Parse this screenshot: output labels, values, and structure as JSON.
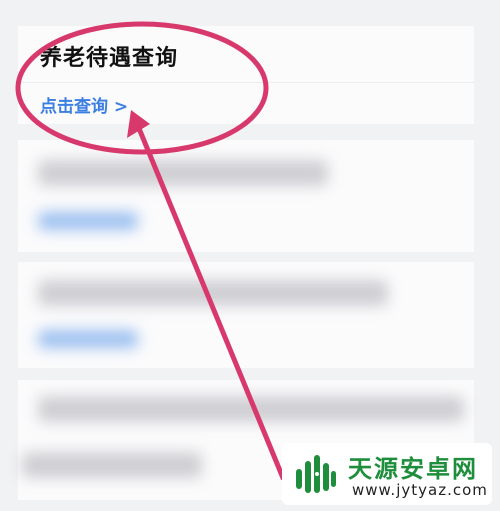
{
  "card": {
    "title": "养老待遇查询",
    "link_label": "点击查询 >"
  },
  "watermark": {
    "site_name": "天源安卓网",
    "site_url": "www.jytyaz.com"
  },
  "colors": {
    "page_background": "#f1f2f4",
    "card_background": "#fbfbfc",
    "link_blue": "#3b7fe0",
    "annotation_pink": "#d8396c",
    "watermark_green": "#1f8e3c"
  },
  "icons": [
    "android-logo-icon"
  ]
}
